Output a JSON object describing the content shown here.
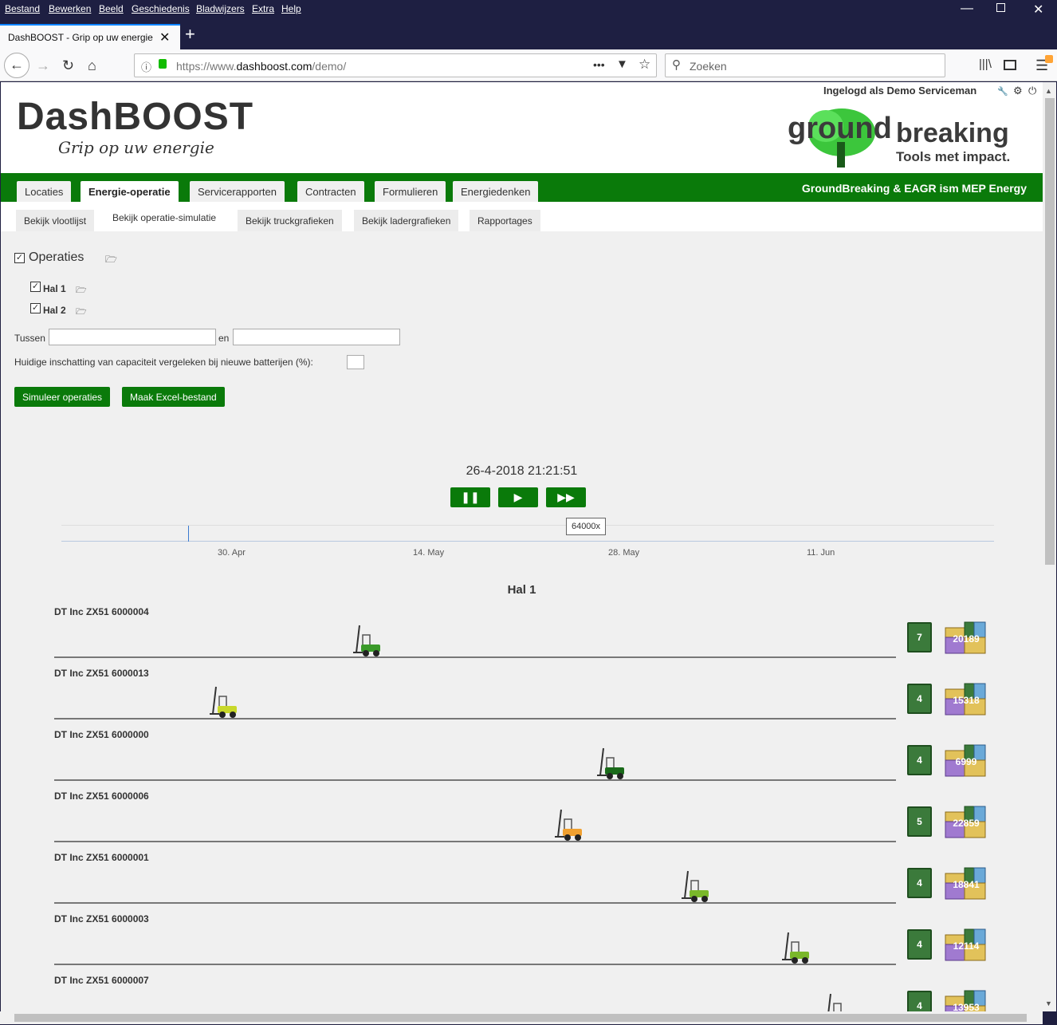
{
  "browser": {
    "menu": [
      "Bestand",
      "Bewerken",
      "Beeld",
      "Geschiedenis",
      "Bladwijzers",
      "Extra",
      "Help"
    ],
    "tab_title": "DashBOOST - Grip op uw energie",
    "url_prefix": "https://www.",
    "url_domain": "dashboost.com",
    "url_path": "/demo/",
    "search_placeholder": "Zoeken"
  },
  "header": {
    "logo": "DashBOOST",
    "slogan": "Grip op uw energie",
    "user_line": "Ingelogd als Demo Serviceman",
    "partner_word1": "ground",
    "partner_word2": "breaking",
    "partner_tagline": "Tools met impact."
  },
  "main_tabs": [
    "Locaties",
    "Energie-operatie",
    "Servicerapporten",
    "Contracten",
    "Formulieren",
    "Energiedenken"
  ],
  "greenbar_title": "GroundBreaking & EAGR ism MEP Energy",
  "sub_tabs": [
    "Bekijk vlootlijst",
    "Bekijk operatie-simulatie",
    "Bekijk truckgrafieken",
    "Bekijk ladergrafieken",
    "Rapportages"
  ],
  "tree": {
    "root": "Operaties",
    "children": [
      "Hal 1",
      "Hal 2"
    ]
  },
  "form": {
    "between_label": "Tussen",
    "and_label": "en",
    "capacity_label": "Huidige inschatting van capaciteit vergeleken bij nieuwe batterijen (%):",
    "simulate_button": "Simuleer operaties",
    "excel_button": "Maak Excel-bestand"
  },
  "sim": {
    "timestamp": "26-4-2018 21:21:51",
    "speed_tooltip": "64000x",
    "ticks": [
      "30. Apr",
      "14. May",
      "28. May",
      "11. Jun"
    ],
    "hall_title": "Hal 1"
  },
  "trucks": [
    {
      "name": "DT Inc ZX51 6000004",
      "batteries": "7",
      "kwh": "20189",
      "pos": 0.37,
      "color": "#3a9a2a"
    },
    {
      "name": "DT Inc ZX51 6000013",
      "batteries": "4",
      "kwh": "15318",
      "pos": 0.2,
      "color": "#c8d82a"
    },
    {
      "name": "DT Inc ZX51 6000000",
      "batteries": "4",
      "kwh": "6999",
      "pos": 0.66,
      "color": "#1a6a1a"
    },
    {
      "name": "DT Inc ZX51 6000006",
      "batteries": "5",
      "kwh": "22859",
      "pos": 0.61,
      "color": "#f0a030"
    },
    {
      "name": "DT Inc ZX51 6000001",
      "batteries": "4",
      "kwh": "18841",
      "pos": 0.76,
      "color": "#7ab82a"
    },
    {
      "name": "DT Inc ZX51 6000003",
      "batteries": "4",
      "kwh": "12114",
      "pos": 0.88,
      "color": "#7ab82a"
    },
    {
      "name": "DT Inc ZX51 6000007",
      "batteries": "4",
      "kwh": "13953",
      "pos": 0.93,
      "color": "#7ab82a"
    }
  ]
}
